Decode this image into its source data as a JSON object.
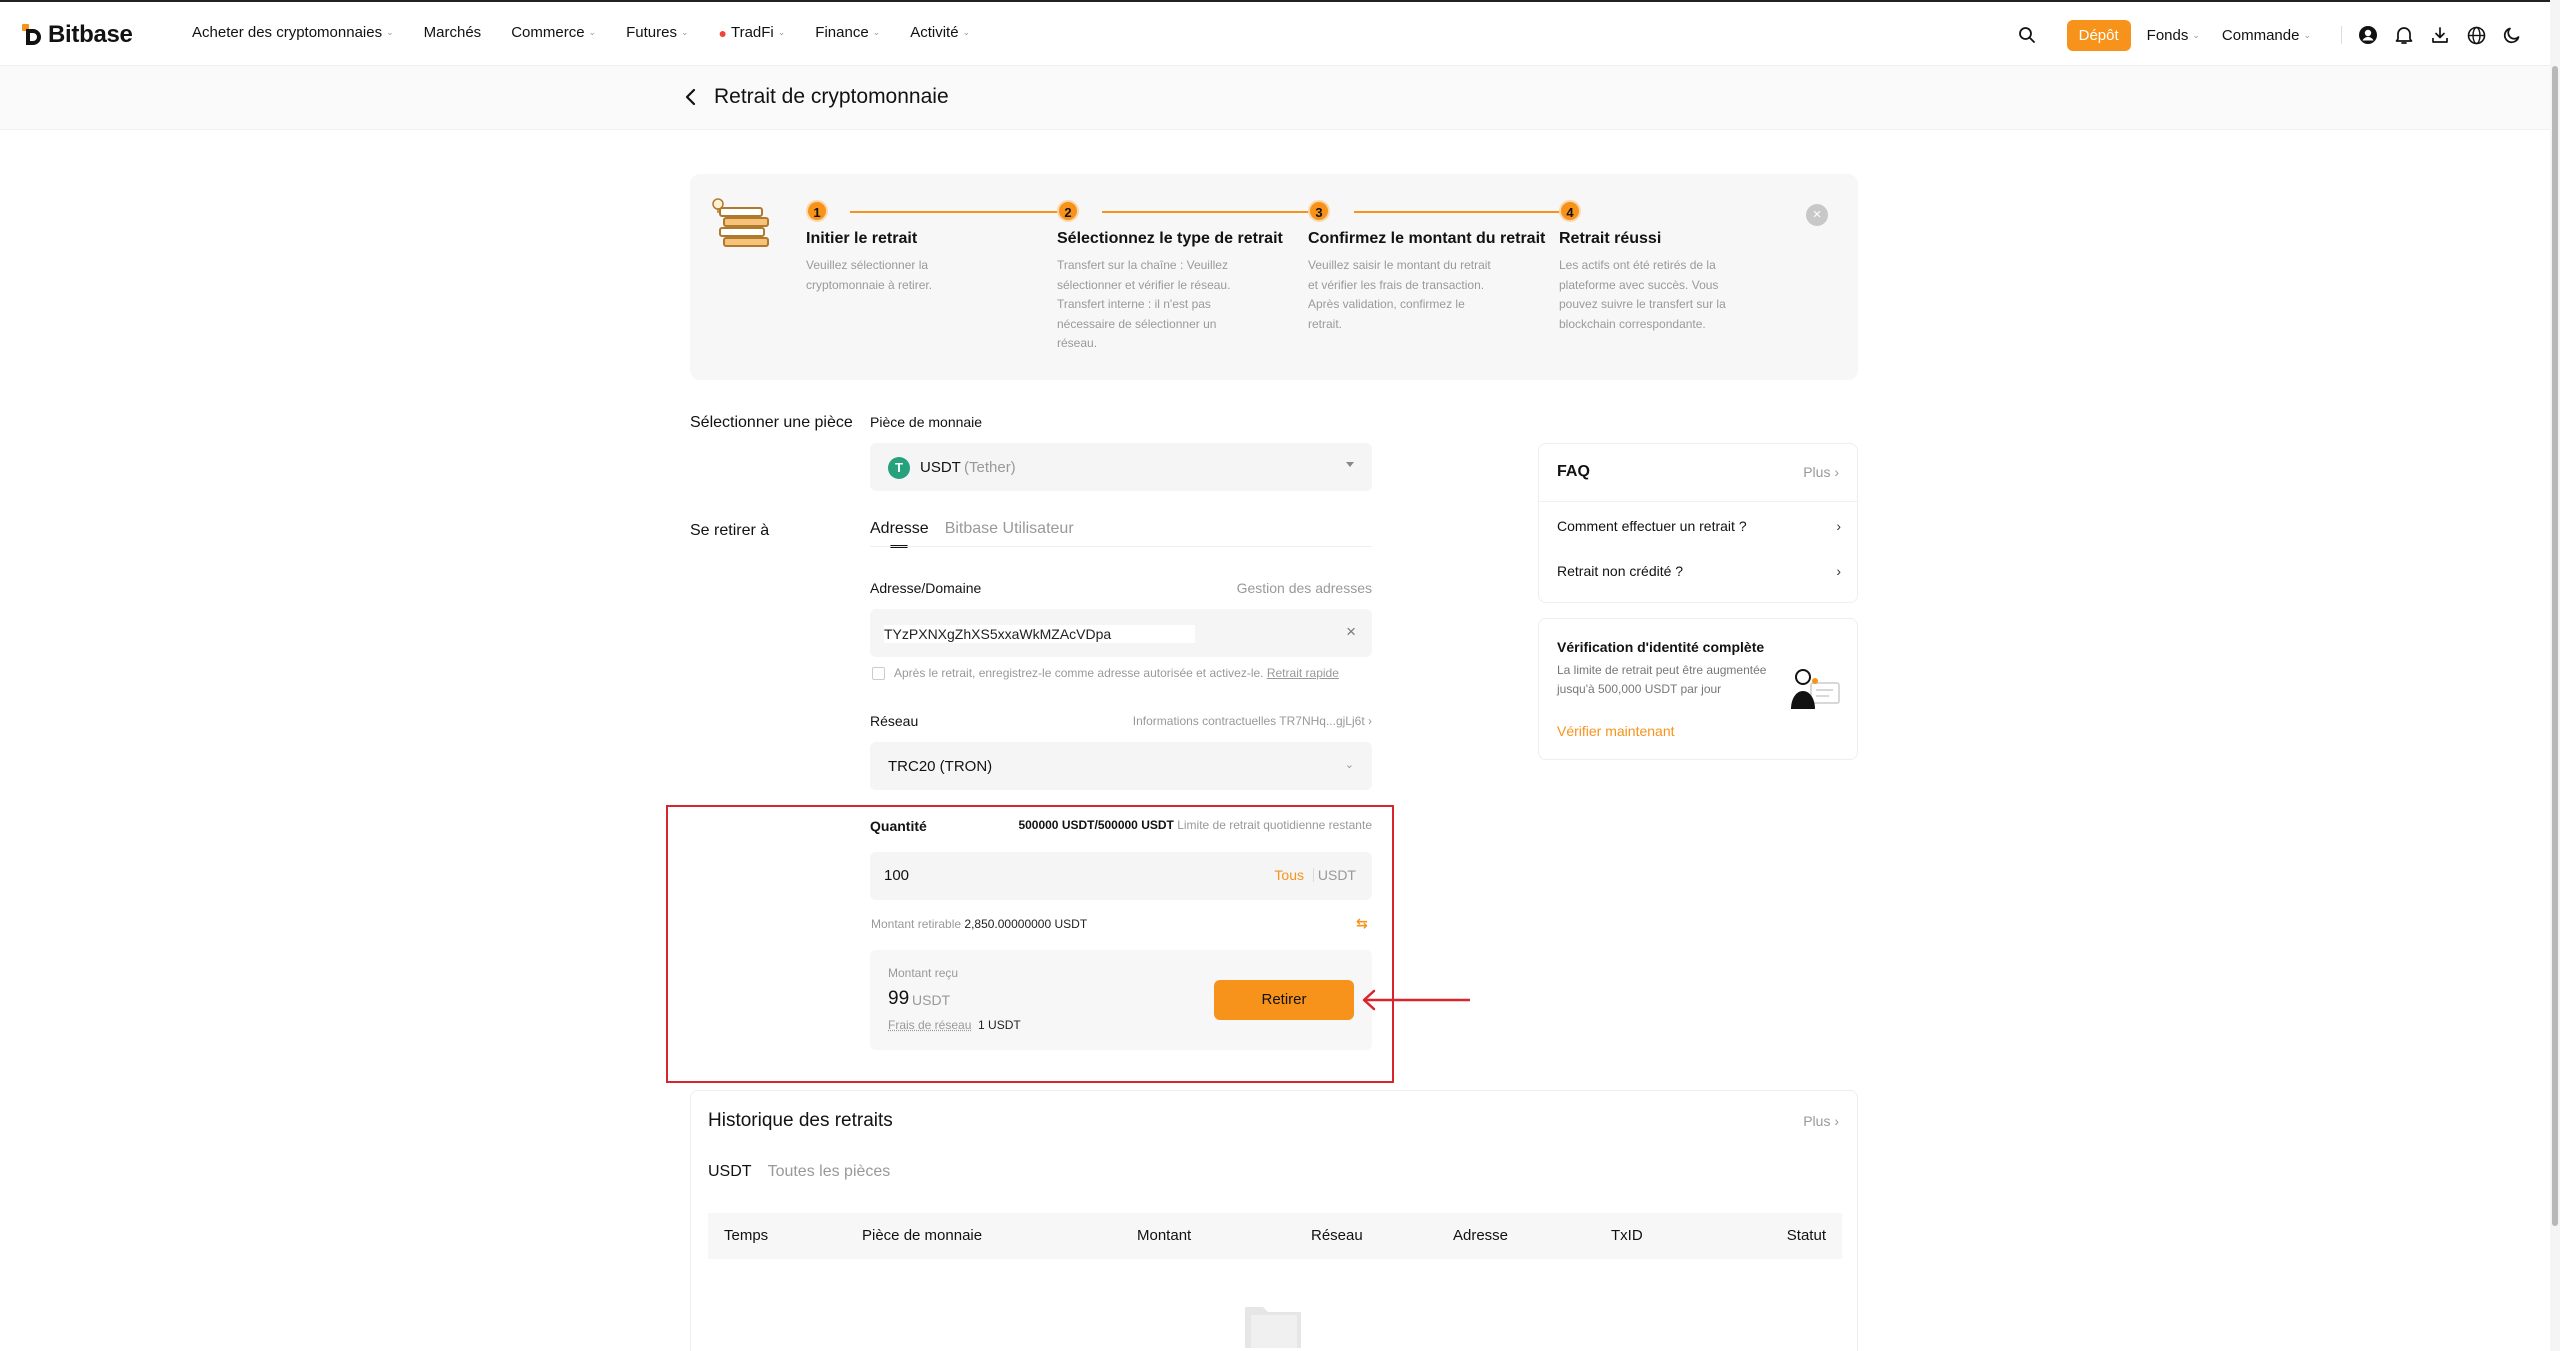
{
  "nav": {
    "brand": "Bitbase",
    "items": [
      {
        "label": "Acheter des cryptomonnaies",
        "has_dropdown": true
      },
      {
        "label": "Marchés",
        "has_dropdown": false
      },
      {
        "label": "Commerce",
        "has_dropdown": true
      },
      {
        "label": "Futures",
        "has_dropdown": true
      },
      {
        "label": "TradFi",
        "has_dropdown": true
      },
      {
        "label": "Finance",
        "has_dropdown": true
      },
      {
        "label": "Activité",
        "has_dropdown": true
      }
    ],
    "deposit_label": "Dépôt",
    "funds_label": "Fonds",
    "orders_label": "Commande",
    "icons": [
      "search-icon",
      "user-icon",
      "bell-icon",
      "download-icon",
      "globe-icon",
      "moon-icon"
    ]
  },
  "page": {
    "title": "Retrait de cryptomonnaie"
  },
  "steps": [
    {
      "num": "1",
      "title": "Initier le retrait",
      "desc": "Veuillez sélectionner la cryptomonnaie à retirer."
    },
    {
      "num": "2",
      "title": "Sélectionnez le type de retrait",
      "desc": "Transfert sur la chaîne : Veuillez sélectionner et vérifier le réseau. Transfert interne : il n'est pas nécessaire de sélectionner un réseau."
    },
    {
      "num": "3",
      "title": "Confirmez le montant du retrait",
      "desc": "Veuillez saisir le montant du retrait et vérifier les frais de transaction. Après validation, confirmez le retrait."
    },
    {
      "num": "4",
      "title": "Retrait réussi",
      "desc": "Les actifs ont été retirés de la plateforme avec succès. Vous pouvez suivre le transfert sur la blockchain correspondante."
    }
  ],
  "form": {
    "select_coin_label": "Sélectionner une pièce",
    "coin_field_label": "Pièce de monnaie",
    "coin_symbol": "USDT",
    "coin_name": "(Tether)",
    "withdraw_to_label": "Se retirer à",
    "tab_address": "Adresse",
    "tab_user": "Bitbase Utilisateur",
    "address_label": "Adresse/Domaine",
    "address_manage": "Gestion des adresses",
    "address_value": "TYzPXNXgZhXS5xxaWkMZAcVDpa",
    "save_checkbox_text": "Après le retrait, enregistrez-le comme adresse autorisée et activez-le.",
    "quick_withdraw_link": "Retrait rapide",
    "network_label": "Réseau",
    "contract_info": "Informations contractuelles TR7NHq...gjLj6t",
    "network_value": "TRC20 (TRON)",
    "quantity_label": "Quantité",
    "daily_limit_value": "500000 USDT/500000 USDT",
    "daily_limit_text": "Limite de retrait quotidienne restante",
    "amount_value": "100",
    "all_label": "Tous",
    "unit": "USDT",
    "withdrawable_label": "Montant retirable",
    "withdrawable_value": "2,850.00000000 USDT",
    "received_label": "Montant reçu",
    "received_amount": "99",
    "received_unit": "USDT",
    "fee_label": "Frais de réseau",
    "fee_value": "1 USDT",
    "submit_label": "Retirer"
  },
  "faq": {
    "title": "FAQ",
    "more": "Plus",
    "items": [
      "Comment effectuer un retrait ?",
      "Retrait non crédité ?"
    ]
  },
  "verify": {
    "title": "Vérification d'identité complète",
    "desc": "La limite de retrait peut être augmentée jusqu'à 500,000 USDT par jour",
    "link": "Vérifier maintenant"
  },
  "history": {
    "title": "Historique des retraits",
    "more": "Plus",
    "tabs": [
      "USDT",
      "Toutes les pièces"
    ],
    "columns": [
      "Temps",
      "Pièce de monnaie",
      "Montant",
      "Réseau",
      "Adresse",
      "TxID",
      "Statut"
    ]
  },
  "colors": {
    "accent": "#f7931a",
    "annotation": "#d9232d",
    "tether": "#26a17b"
  }
}
